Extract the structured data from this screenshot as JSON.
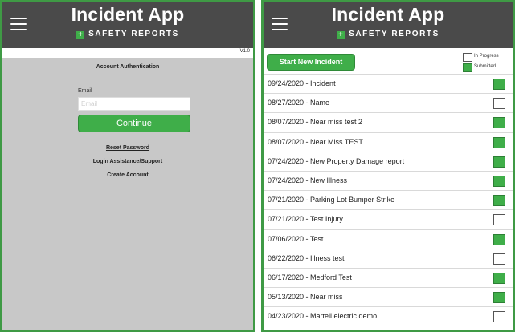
{
  "app": {
    "title": "Incident App",
    "subtitle": "SAFETY REPORTS",
    "plus_symbol": "+",
    "colors": {
      "header_bg": "#4a4a4a",
      "accent": "#3fae49",
      "frame": "#3f9a45"
    }
  },
  "login": {
    "version": "V1.0",
    "heading": "Account Authentication",
    "email_label": "Email",
    "email_placeholder": "Email",
    "email_value": "",
    "continue_label": "Continue",
    "reset_password": "Reset Password",
    "login_assistance": "Login Assistance/Support",
    "create_account": "Create Account"
  },
  "incidents": {
    "start_button": "Start New Incident",
    "legend": {
      "in_progress": "In Progress",
      "submitted": "Submitted"
    },
    "items": [
      {
        "label": "09/24/2020 - Incident",
        "status": "submitted"
      },
      {
        "label": "08/27/2020 - Name",
        "status": "in_progress"
      },
      {
        "label": "08/07/2020 - Near miss test 2",
        "status": "submitted"
      },
      {
        "label": "08/07/2020 - Near Miss TEST",
        "status": "submitted"
      },
      {
        "label": "07/24/2020 - New Property Damage report",
        "status": "submitted"
      },
      {
        "label": "07/24/2020 - New Illness",
        "status": "submitted"
      },
      {
        "label": "07/21/2020 - Parking Lot Bumper Strike",
        "status": "submitted"
      },
      {
        "label": "07/21/2020 - Test Injury",
        "status": "in_progress"
      },
      {
        "label": "07/06/2020 - Test",
        "status": "submitted"
      },
      {
        "label": "06/22/2020 - Illness test",
        "status": "in_progress"
      },
      {
        "label": "06/17/2020 - Medford Test",
        "status": "submitted"
      },
      {
        "label": "05/13/2020 - Near miss",
        "status": "submitted"
      },
      {
        "label": "04/23/2020 - Martell electric demo",
        "status": "in_progress"
      }
    ]
  }
}
